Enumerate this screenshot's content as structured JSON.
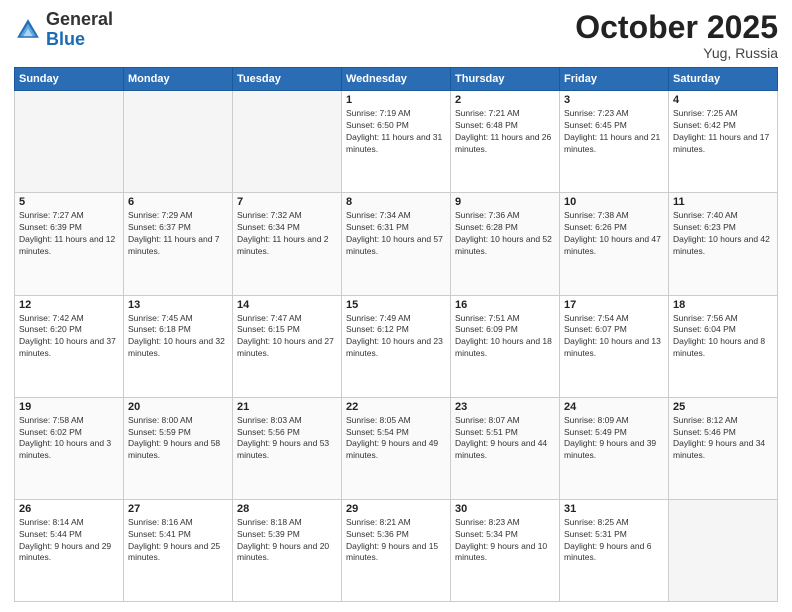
{
  "header": {
    "logo_general": "General",
    "logo_blue": "Blue",
    "month_title": "October 2025",
    "location": "Yug, Russia"
  },
  "weekdays": [
    "Sunday",
    "Monday",
    "Tuesday",
    "Wednesday",
    "Thursday",
    "Friday",
    "Saturday"
  ],
  "weeks": [
    [
      {
        "day": "",
        "sunrise": "",
        "sunset": "",
        "daylight": ""
      },
      {
        "day": "",
        "sunrise": "",
        "sunset": "",
        "daylight": ""
      },
      {
        "day": "",
        "sunrise": "",
        "sunset": "",
        "daylight": ""
      },
      {
        "day": "1",
        "sunrise": "Sunrise: 7:19 AM",
        "sunset": "Sunset: 6:50 PM",
        "daylight": "Daylight: 11 hours and 31 minutes."
      },
      {
        "day": "2",
        "sunrise": "Sunrise: 7:21 AM",
        "sunset": "Sunset: 6:48 PM",
        "daylight": "Daylight: 11 hours and 26 minutes."
      },
      {
        "day": "3",
        "sunrise": "Sunrise: 7:23 AM",
        "sunset": "Sunset: 6:45 PM",
        "daylight": "Daylight: 11 hours and 21 minutes."
      },
      {
        "day": "4",
        "sunrise": "Sunrise: 7:25 AM",
        "sunset": "Sunset: 6:42 PM",
        "daylight": "Daylight: 11 hours and 17 minutes."
      }
    ],
    [
      {
        "day": "5",
        "sunrise": "Sunrise: 7:27 AM",
        "sunset": "Sunset: 6:39 PM",
        "daylight": "Daylight: 11 hours and 12 minutes."
      },
      {
        "day": "6",
        "sunrise": "Sunrise: 7:29 AM",
        "sunset": "Sunset: 6:37 PM",
        "daylight": "Daylight: 11 hours and 7 minutes."
      },
      {
        "day": "7",
        "sunrise": "Sunrise: 7:32 AM",
        "sunset": "Sunset: 6:34 PM",
        "daylight": "Daylight: 11 hours and 2 minutes."
      },
      {
        "day": "8",
        "sunrise": "Sunrise: 7:34 AM",
        "sunset": "Sunset: 6:31 PM",
        "daylight": "Daylight: 10 hours and 57 minutes."
      },
      {
        "day": "9",
        "sunrise": "Sunrise: 7:36 AM",
        "sunset": "Sunset: 6:28 PM",
        "daylight": "Daylight: 10 hours and 52 minutes."
      },
      {
        "day": "10",
        "sunrise": "Sunrise: 7:38 AM",
        "sunset": "Sunset: 6:26 PM",
        "daylight": "Daylight: 10 hours and 47 minutes."
      },
      {
        "day": "11",
        "sunrise": "Sunrise: 7:40 AM",
        "sunset": "Sunset: 6:23 PM",
        "daylight": "Daylight: 10 hours and 42 minutes."
      }
    ],
    [
      {
        "day": "12",
        "sunrise": "Sunrise: 7:42 AM",
        "sunset": "Sunset: 6:20 PM",
        "daylight": "Daylight: 10 hours and 37 minutes."
      },
      {
        "day": "13",
        "sunrise": "Sunrise: 7:45 AM",
        "sunset": "Sunset: 6:18 PM",
        "daylight": "Daylight: 10 hours and 32 minutes."
      },
      {
        "day": "14",
        "sunrise": "Sunrise: 7:47 AM",
        "sunset": "Sunset: 6:15 PM",
        "daylight": "Daylight: 10 hours and 27 minutes."
      },
      {
        "day": "15",
        "sunrise": "Sunrise: 7:49 AM",
        "sunset": "Sunset: 6:12 PM",
        "daylight": "Daylight: 10 hours and 23 minutes."
      },
      {
        "day": "16",
        "sunrise": "Sunrise: 7:51 AM",
        "sunset": "Sunset: 6:09 PM",
        "daylight": "Daylight: 10 hours and 18 minutes."
      },
      {
        "day": "17",
        "sunrise": "Sunrise: 7:54 AM",
        "sunset": "Sunset: 6:07 PM",
        "daylight": "Daylight: 10 hours and 13 minutes."
      },
      {
        "day": "18",
        "sunrise": "Sunrise: 7:56 AM",
        "sunset": "Sunset: 6:04 PM",
        "daylight": "Daylight: 10 hours and 8 minutes."
      }
    ],
    [
      {
        "day": "19",
        "sunrise": "Sunrise: 7:58 AM",
        "sunset": "Sunset: 6:02 PM",
        "daylight": "Daylight: 10 hours and 3 minutes."
      },
      {
        "day": "20",
        "sunrise": "Sunrise: 8:00 AM",
        "sunset": "Sunset: 5:59 PM",
        "daylight": "Daylight: 9 hours and 58 minutes."
      },
      {
        "day": "21",
        "sunrise": "Sunrise: 8:03 AM",
        "sunset": "Sunset: 5:56 PM",
        "daylight": "Daylight: 9 hours and 53 minutes."
      },
      {
        "day": "22",
        "sunrise": "Sunrise: 8:05 AM",
        "sunset": "Sunset: 5:54 PM",
        "daylight": "Daylight: 9 hours and 49 minutes."
      },
      {
        "day": "23",
        "sunrise": "Sunrise: 8:07 AM",
        "sunset": "Sunset: 5:51 PM",
        "daylight": "Daylight: 9 hours and 44 minutes."
      },
      {
        "day": "24",
        "sunrise": "Sunrise: 8:09 AM",
        "sunset": "Sunset: 5:49 PM",
        "daylight": "Daylight: 9 hours and 39 minutes."
      },
      {
        "day": "25",
        "sunrise": "Sunrise: 8:12 AM",
        "sunset": "Sunset: 5:46 PM",
        "daylight": "Daylight: 9 hours and 34 minutes."
      }
    ],
    [
      {
        "day": "26",
        "sunrise": "Sunrise: 8:14 AM",
        "sunset": "Sunset: 5:44 PM",
        "daylight": "Daylight: 9 hours and 29 minutes."
      },
      {
        "day": "27",
        "sunrise": "Sunrise: 8:16 AM",
        "sunset": "Sunset: 5:41 PM",
        "daylight": "Daylight: 9 hours and 25 minutes."
      },
      {
        "day": "28",
        "sunrise": "Sunrise: 8:18 AM",
        "sunset": "Sunset: 5:39 PM",
        "daylight": "Daylight: 9 hours and 20 minutes."
      },
      {
        "day": "29",
        "sunrise": "Sunrise: 8:21 AM",
        "sunset": "Sunset: 5:36 PM",
        "daylight": "Daylight: 9 hours and 15 minutes."
      },
      {
        "day": "30",
        "sunrise": "Sunrise: 8:23 AM",
        "sunset": "Sunset: 5:34 PM",
        "daylight": "Daylight: 9 hours and 10 minutes."
      },
      {
        "day": "31",
        "sunrise": "Sunrise: 8:25 AM",
        "sunset": "Sunset: 5:31 PM",
        "daylight": "Daylight: 9 hours and 6 minutes."
      },
      {
        "day": "",
        "sunrise": "",
        "sunset": "",
        "daylight": ""
      }
    ]
  ]
}
